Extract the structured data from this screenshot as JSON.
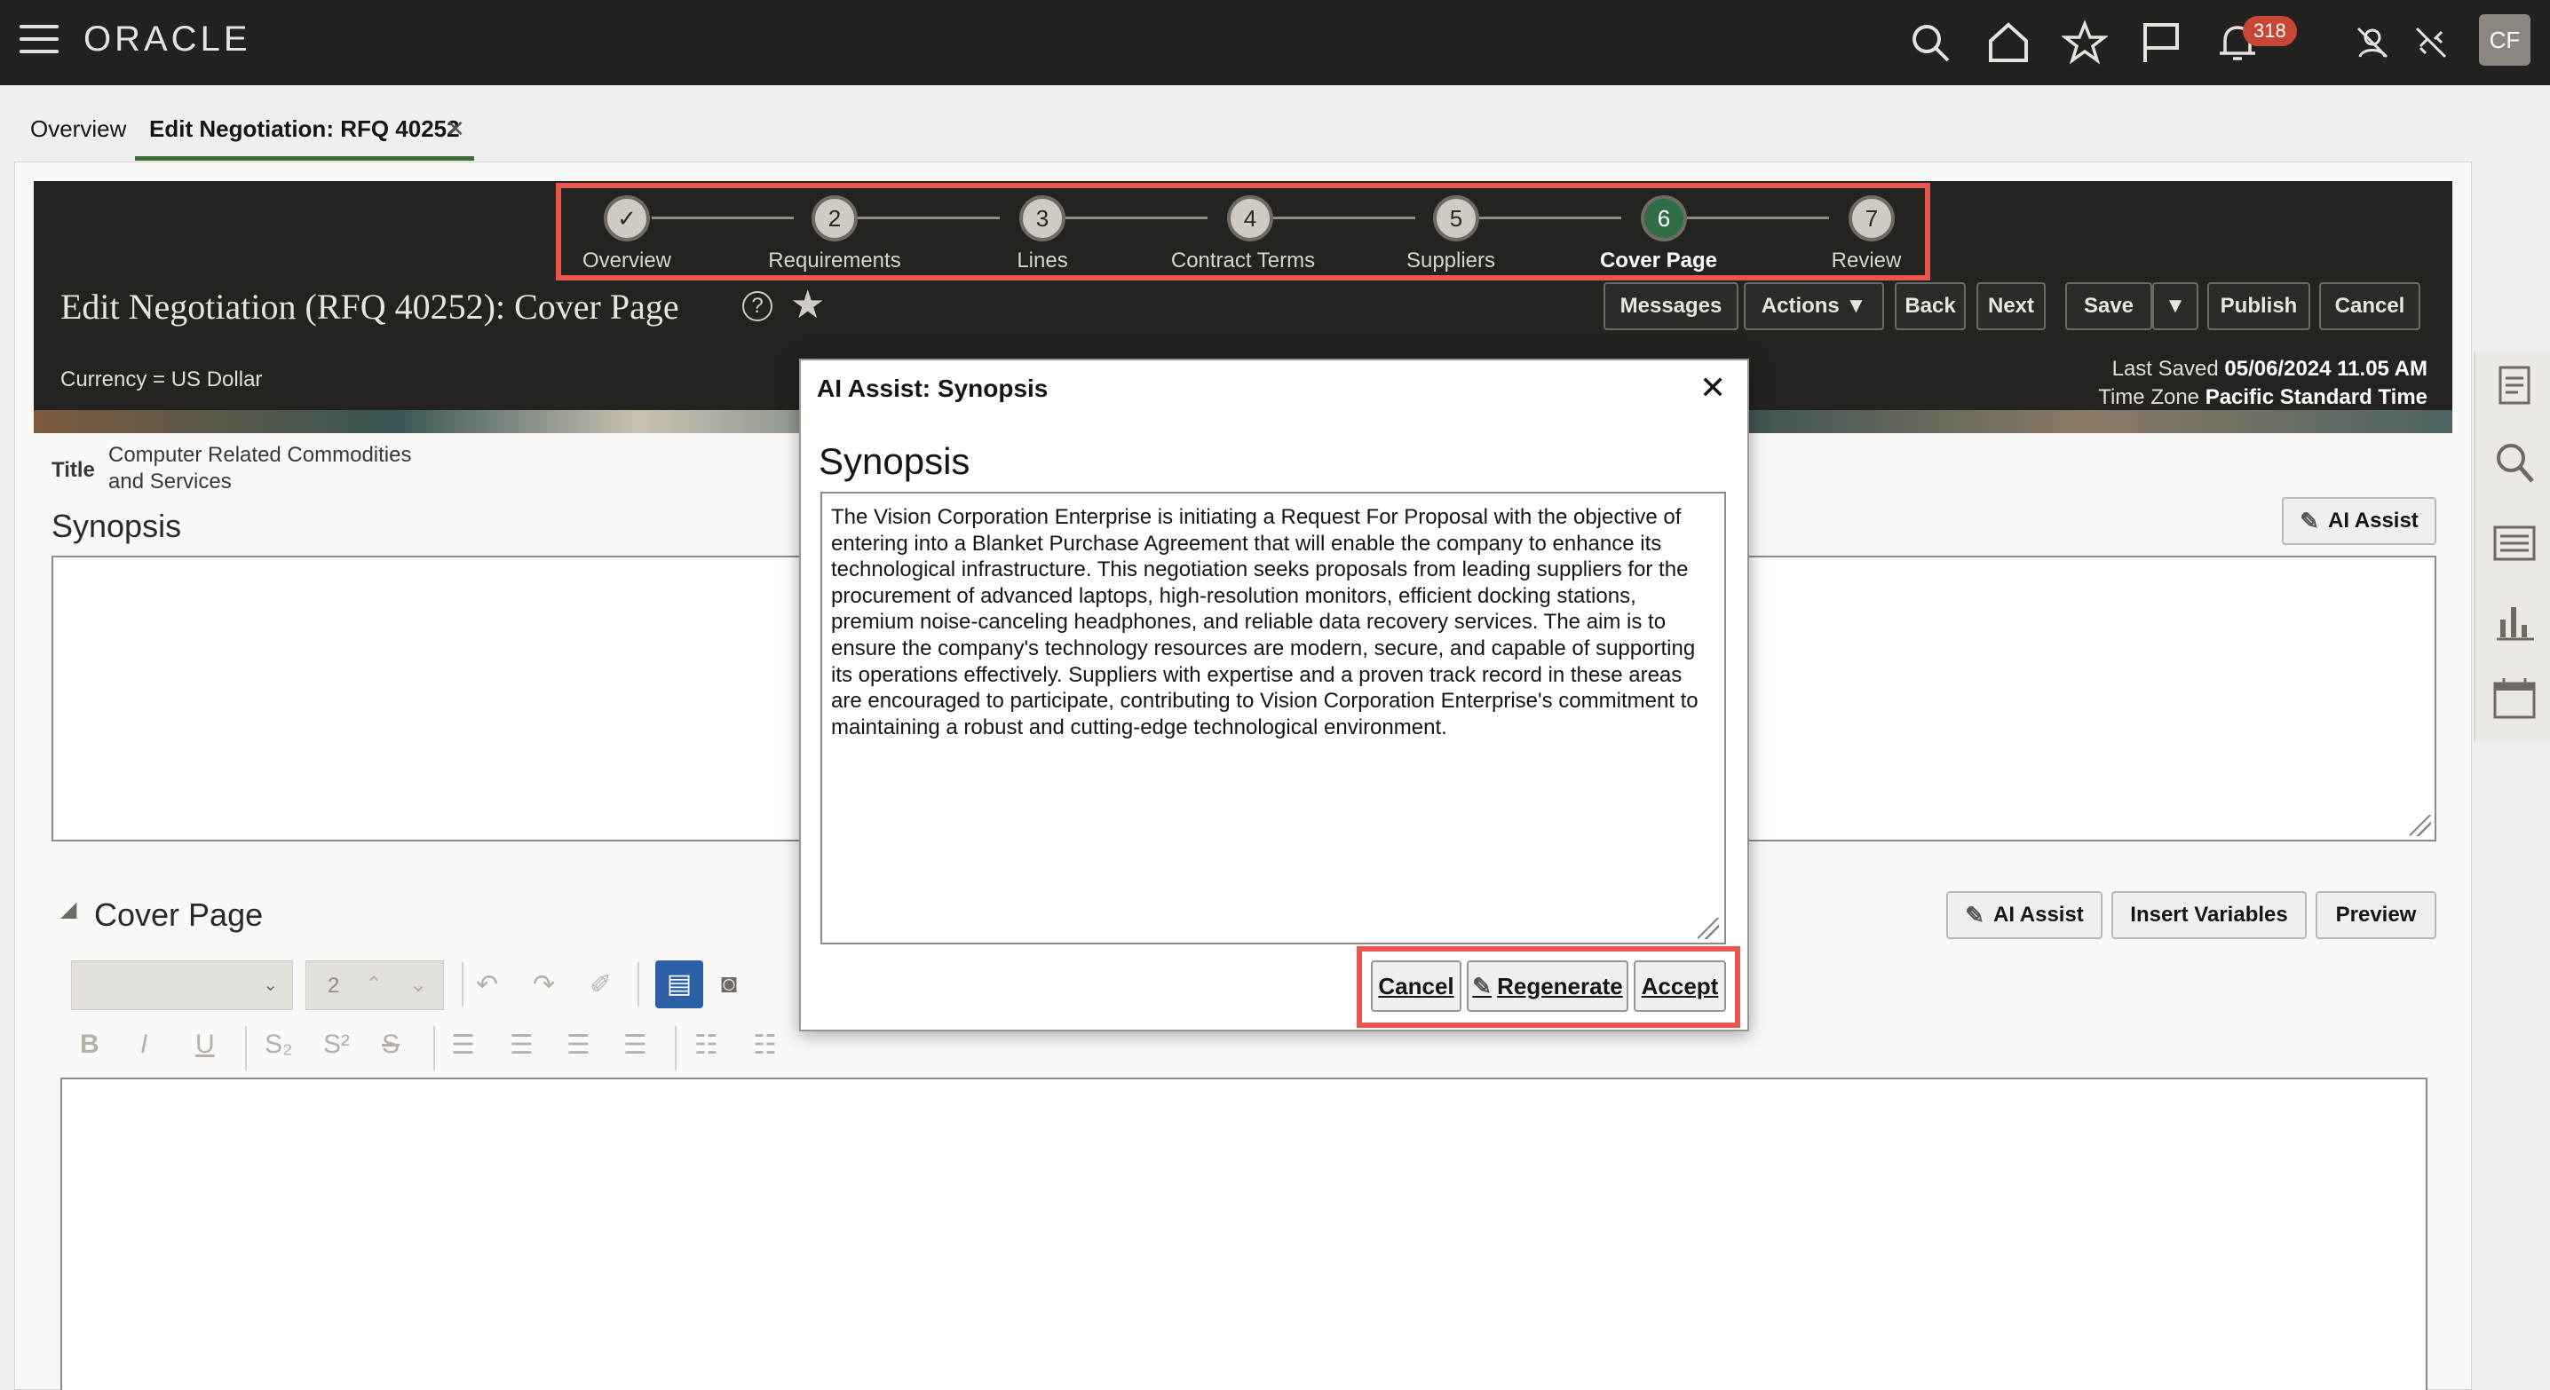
{
  "topbar": {
    "logo": "ORACLE",
    "notification_count": "318",
    "avatar_initials": "CF",
    "icons": [
      "hamburger-icon",
      "search-icon",
      "home-icon",
      "star-icon",
      "flag-icon",
      "bell-icon",
      "user-off-icon",
      "link-off-icon"
    ]
  },
  "tabs": [
    {
      "label": "Overview"
    },
    {
      "label": "Edit Negotiation: RFQ 40252",
      "active": true
    }
  ],
  "header": {
    "title": "Edit Negotiation (RFQ 40252): Cover Page",
    "currency": "Currency = US Dollar",
    "last_saved_label": "Last Saved",
    "last_saved_value": "05/06/2024 11.05 AM",
    "timezone_label": "Time Zone",
    "timezone_value": "Pacific Standard Time",
    "buttons": {
      "messages": "Messages",
      "actions": "Actions",
      "back": "Back",
      "next": "Next",
      "save": "Save",
      "publish": "Publish",
      "cancel": "Cancel"
    }
  },
  "train": [
    {
      "number": "✓",
      "label": "Overview"
    },
    {
      "number": "2",
      "label": "Requirements"
    },
    {
      "number": "3",
      "label": "Lines"
    },
    {
      "number": "4",
      "label": "Contract Terms"
    },
    {
      "number": "5",
      "label": "Suppliers"
    },
    {
      "number": "6",
      "label": "Cover Page",
      "current": true
    },
    {
      "number": "7",
      "label": "Review"
    }
  ],
  "body": {
    "title_label": "Title",
    "title_value": "Computer Related Commodities and Services",
    "synopsis_heading": "Synopsis",
    "ai_assist": "AI Assist",
    "cover_page_heading": "Cover Page",
    "insert_variables": "Insert Variables",
    "preview": "Preview",
    "font_size": "2"
  },
  "modal": {
    "title": "AI Assist: Synopsis",
    "heading": "Synopsis",
    "text": "The Vision Corporation Enterprise is initiating a Request For Proposal with the objective of entering into a Blanket Purchase Agreement that will enable the company to enhance its technological infrastructure. This negotiation seeks proposals from leading suppliers for the procurement of advanced laptops, high-resolution monitors, efficient docking stations, premium noise-canceling headphones, and reliable data recovery services. The aim is to ensure the company's technology resources are modern, secure, and capable of supporting its operations effectively. Suppliers with expertise and a proven track record in these areas are encouraged to participate, contributing to Vision Corporation Enterprise's commitment to maintaining a robust and cutting-edge technological environment.",
    "cancel": "Cancel",
    "regenerate": "Regenerate",
    "accept": "Accept"
  },
  "colors": {
    "topbar": "#242220",
    "accent_highlight": "#e7574d",
    "current_step": "#2f6e44",
    "badge": "#c74634"
  }
}
